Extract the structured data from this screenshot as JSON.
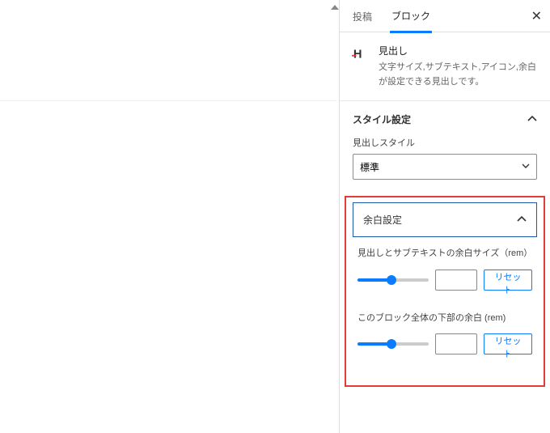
{
  "tabs": {
    "post": "投稿",
    "block": "ブロック"
  },
  "blockCard": {
    "title": "見出し",
    "description": "文字サイズ,サブテキスト,アイコン,余白が設定できる見出しです。"
  },
  "styleSection": {
    "title": "スタイル設定",
    "styleLabel": "見出しスタイル",
    "styleValue": "標準"
  },
  "marginSection": {
    "title": "余白設定",
    "subTextLabel": "見出しとサブテキストの余白サイズ（rem）",
    "bottomLabel": "このブロック全体の下部の余白 (rem)",
    "reset": "リセット"
  }
}
